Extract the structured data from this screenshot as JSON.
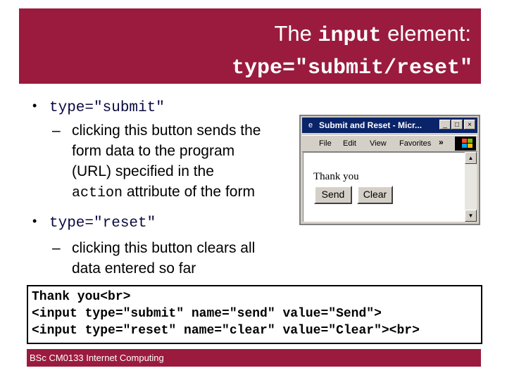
{
  "title": {
    "line1_prefix": "The ",
    "line1_code": "input",
    "line1_suffix": " element:",
    "line2": "type=\"submit/reset\""
  },
  "bullets": [
    {
      "code": "type=\"submit\"",
      "sub_lines": [
        "clicking this button sends the",
        "form data to the program",
        "(URL) specified in the"
      ],
      "sub_last_code": "action",
      "sub_last_suffix": " attribute of the form"
    },
    {
      "code": "type=\"reset\"",
      "sub_lines": [
        "clicking this button clears all",
        "data entered so far"
      ]
    }
  ],
  "bullet_glyph": "•",
  "dash_glyph": "–",
  "browser": {
    "title": "Submit and Reset - Micr...",
    "menu": [
      "File",
      "Edit",
      "View",
      "Favorites"
    ],
    "more": "»",
    "content_text": "Thank you",
    "send_label": "Send",
    "clear_label": "Clear",
    "minimize": "_",
    "maximize": "□",
    "close": "×",
    "icon": "ie-icon",
    "logo": "windows-logo-icon"
  },
  "code_box": [
    "Thank you<br>",
    "<input type=\"submit\" name=\"send\" value=\"Send\">",
    "<input type=\"reset\" name=\"clear\" value=\"Clear\"><br>"
  ],
  "footer": "BSc CM0133 Internet Computing",
  "colors": {
    "accent": "#9a1b3e",
    "window_title": "#0a246a"
  }
}
